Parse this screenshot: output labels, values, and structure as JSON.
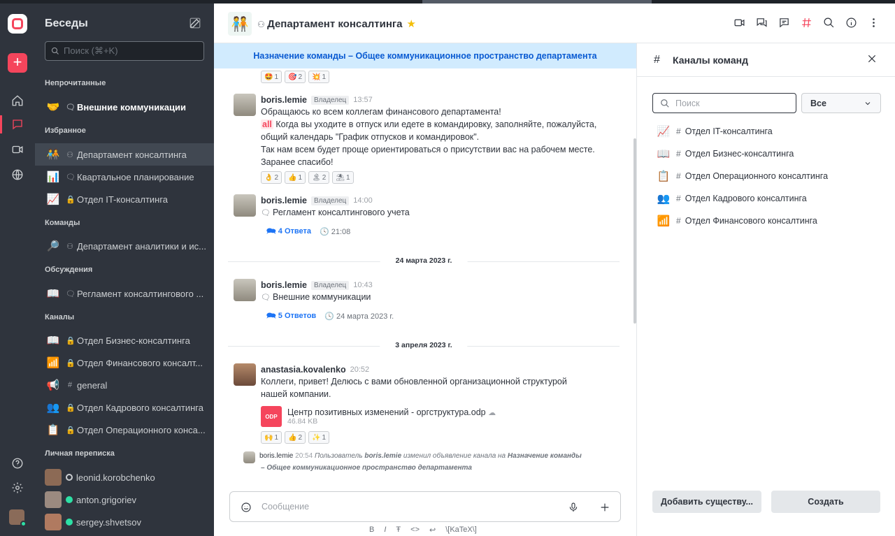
{
  "sidebar": {
    "title": "Беседы",
    "search_placeholder": "Поиск (⌘+K)",
    "sections": {
      "unread": "Непрочитанные",
      "favorites": "Избранное",
      "teams": "Команды",
      "discussions": "Обсуждения",
      "channels": "Каналы",
      "direct": "Личная переписка"
    },
    "unread_items": [
      {
        "label": "Внешние коммуникации",
        "icon": "💬"
      }
    ],
    "favorite_items": [
      {
        "label": "Департамент консалтинга"
      },
      {
        "label": "Квартальное планирование"
      },
      {
        "label": "Отдел IT-консалтинга"
      }
    ],
    "team_items": [
      {
        "label": "Департамент аналитики и ис..."
      }
    ],
    "discussion_items": [
      {
        "label": "Регламент консалтингового ..."
      }
    ],
    "channel_items": [
      {
        "label": "Отдел Бизнес-консалтинга"
      },
      {
        "label": "Отдел Финансового консалт..."
      },
      {
        "label": "general"
      },
      {
        "label": "Отдел Кадрового консалтинга"
      },
      {
        "label": "Отдел Операционного конса..."
      }
    ],
    "direct_items": [
      {
        "label": "leonid.korobchenko",
        "status": "offline"
      },
      {
        "label": "anton.grigoriev",
        "status": "online"
      },
      {
        "label": "sergey.shvetsov",
        "status": "online"
      }
    ]
  },
  "header": {
    "room_title": "Департамент консалтинга"
  },
  "announcement": "Назначение команды – Общее коммуникационное пространство департамента",
  "messages": {
    "top_reactions": [
      "1",
      "2",
      "1"
    ],
    "m1": {
      "author": "boris.lemie",
      "role": "Владелец",
      "time": "13:57",
      "line1": "Обращаюсь ко всем коллегам финансового департамента!",
      "mention": "all",
      "line2": " Когда вы уходите в отпуск или едете в командировку, заполняйте, пожалуйста,",
      "line3": "общий календарь \"График отпусков и командировок\".",
      "line4": "Так нам всем будет проще ориентироваться о присутствии вас на рабочем месте.",
      "line5": "Заранее спасибо!",
      "reactions": [
        "2",
        "1",
        "2",
        "1"
      ]
    },
    "m2": {
      "author": "boris.lemie",
      "role": "Владелец",
      "time": "14:00",
      "text": "Регламент консалтингового учета",
      "thread_count": "4 Ответа",
      "thread_time": "21:08"
    },
    "date1": "24 марта 2023 г.",
    "m3": {
      "author": "boris.lemie",
      "role": "Владелец",
      "time": "10:43",
      "text": "Внешние коммуникации",
      "thread_count": "5 Ответов",
      "thread_time": "24 марта 2023 г."
    },
    "date2": "3 апреля 2023 г.",
    "m4": {
      "author": "anastasia.kovalenko",
      "time": "20:52",
      "line1": "Коллеги, привет! Делюсь с вами обновленной организационной структурой",
      "line2": "нашей компании.",
      "file_type": "ODP",
      "file_name": "Центр позитивных изменений - оргструктура.odp",
      "file_size": "46.84 KB",
      "reactions": [
        "1",
        "2",
        "1"
      ]
    },
    "sys": {
      "author": "boris.lemie",
      "time": "20:54",
      "text_a": "Пользователь ",
      "user": "boris.lemie",
      "text_b": " изменил объявление канала на ",
      "value_a": "Назначение команды",
      "value_b": "– Общее коммуникационное пространство департамента"
    }
  },
  "composer": {
    "placeholder": "Сообщение",
    "formats": [
      "B",
      "I",
      "Ŧ",
      "<>",
      "↩",
      "\\[KaTeX\\]"
    ]
  },
  "right_panel": {
    "title": "Каналы команд",
    "search_placeholder": "Поиск",
    "filter_value": "Все",
    "channels": [
      "Отдел IT-консалтинга",
      "Отдел Бизнес-консалтинга",
      "Отдел Операционного консалтинга",
      "Отдел Кадрового консалтинга",
      "Отдел Финансового консалтинга"
    ],
    "add_button": "Добавить существу...",
    "create_button": "Создать"
  },
  "colors": {
    "accent": "#f5455c",
    "sidebar_bg": "#2f343d",
    "announcement_bg": "#d1ebfe",
    "link": "#1d74f5",
    "online": "#2de0a5"
  }
}
